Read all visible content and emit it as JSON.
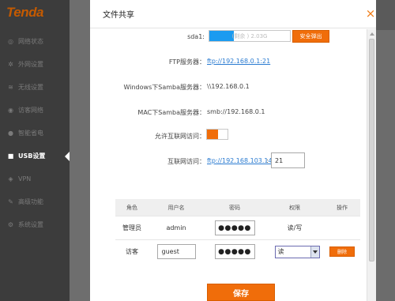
{
  "brand": {
    "logo": "Tenda"
  },
  "sidebar": {
    "items": [
      {
        "label": "网络状态",
        "icon": "globe-icon"
      },
      {
        "label": "外网设置",
        "icon": "gear-icon"
      },
      {
        "label": "无线设置",
        "icon": "wifi-icon"
      },
      {
        "label": "访客网络",
        "icon": "pin-icon"
      },
      {
        "label": "智能省电",
        "icon": "bulb-icon"
      },
      {
        "label": "USB设置",
        "icon": "lock-icon",
        "active": true
      },
      {
        "label": "VPN",
        "icon": "vpn-icon"
      },
      {
        "label": "高级功能",
        "icon": "wrench-icon"
      },
      {
        "label": "系统设置",
        "icon": "cog-icon"
      }
    ]
  },
  "modal": {
    "title": "文件共享",
    "close_symbol": "×",
    "disk": {
      "label": "sda1:",
      "usage_text": "(剩余 ) 2.03G",
      "used_fraction": 0.3,
      "eject_label": "安全弹出"
    },
    "ftp": {
      "label": "FTP服务器：",
      "value": "ftp://192.168.0.1:21"
    },
    "windows_samba": {
      "label": "Windows下Samba服务器：",
      "value": "\\\\192.168.0.1"
    },
    "mac_samba": {
      "label": "MAC下Samba服务器：",
      "value": "smb://192.168.0.1"
    },
    "internet_access": {
      "label": "允许互联网访问：",
      "enabled": true
    },
    "internet_url": {
      "label": "互联网访问：",
      "value": "ftp://192.168.103.143",
      "separator": ":",
      "port": "21"
    },
    "table": {
      "headers": {
        "role": "角色",
        "username": "用户名",
        "password": "密码",
        "permission": "权限",
        "action": "操作"
      },
      "rows": [
        {
          "role": "管理员",
          "username": "admin",
          "password": "●●●●●",
          "permission": "读/写"
        },
        {
          "role": "访客",
          "username": "guest",
          "password": "●●●●●",
          "permission": "读",
          "delete_label": "删除"
        }
      ]
    },
    "save_label": "保存"
  },
  "colors": {
    "accent": "#f06d0a",
    "link": "#2a7bd1",
    "progress": "#1b9bf0",
    "sidebar_bg": "#3c3c3c"
  }
}
